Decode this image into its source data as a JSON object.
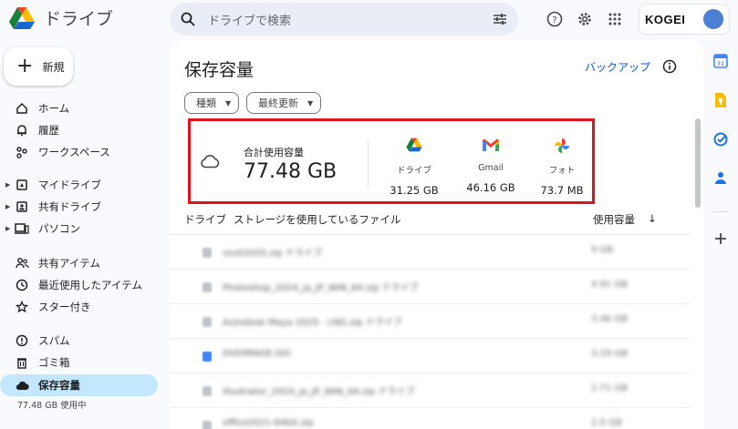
{
  "header": {
    "app_name": "ドライブ",
    "search_placeholder": "ドライブで検索",
    "org_logo_text": "KOGEI"
  },
  "sidebar": {
    "new_label": "新規",
    "items": [
      {
        "label": "ホーム",
        "icon": "home-icon"
      },
      {
        "label": "履歴",
        "icon": "bell-icon"
      },
      {
        "label": "ワークスペース",
        "icon": "workspace-icon"
      },
      {
        "label": "マイドライブ",
        "icon": "my-drive-icon"
      },
      {
        "label": "共有ドライブ",
        "icon": "shared-drive-icon"
      },
      {
        "label": "パソコン",
        "icon": "computer-icon"
      },
      {
        "label": "共有アイテム",
        "icon": "people-icon"
      },
      {
        "label": "最近使用したアイテム",
        "icon": "clock-icon"
      },
      {
        "label": "スター付き",
        "icon": "star-icon"
      },
      {
        "label": "スパム",
        "icon": "spam-icon"
      },
      {
        "label": "ゴミ箱",
        "icon": "trash-icon"
      },
      {
        "label": "保存容量",
        "icon": "cloud-icon"
      }
    ],
    "usage_text": "77.48 GB 使用中"
  },
  "main": {
    "title": "保存容量",
    "backup_link": "バックアップ",
    "filters": [
      {
        "label": "種類"
      },
      {
        "label": "最終更新"
      }
    ],
    "storage": {
      "total_label": "合計使用容量",
      "total_value": "77.48 GB",
      "services": [
        {
          "name": "ドライブ",
          "value": "31.25 GB",
          "icon": "drive-icon"
        },
        {
          "name": "Gmail",
          "value": "46.16 GB",
          "icon": "gmail-icon"
        },
        {
          "name": "フォト",
          "value": "73.7 MB",
          "icon": "photos-icon"
        }
      ]
    },
    "table": {
      "col_source": "ドライブ",
      "col_files": "ストレージを使用しているファイル",
      "col_usage": "使用容量",
      "rows": [
        {
          "name": "revit2025.zip  ドライブ",
          "size": "9 GB"
        },
        {
          "name": "Photoshop_2024_ja_JP_WIN_64.zip  ドライブ",
          "size": "4.91 GB"
        },
        {
          "name": "Autodesk Maya 2025 - LNG.zip  ドライブ",
          "size": "3.46 GB"
        },
        {
          "name": "DVDIMAGE.ISO",
          "size": "3.29 GB"
        },
        {
          "name": "Illustrator_2024_ja_JP_WIN_64.zip  ドライブ",
          "size": "2.71 GB"
        },
        {
          "name": "office2021-64bit.zip",
          "size": "2.5 GB"
        }
      ]
    }
  },
  "colors": {
    "accent": "#0b57d0",
    "active_nav": "#c2e7ff",
    "highlight_border": "#e0121f"
  }
}
